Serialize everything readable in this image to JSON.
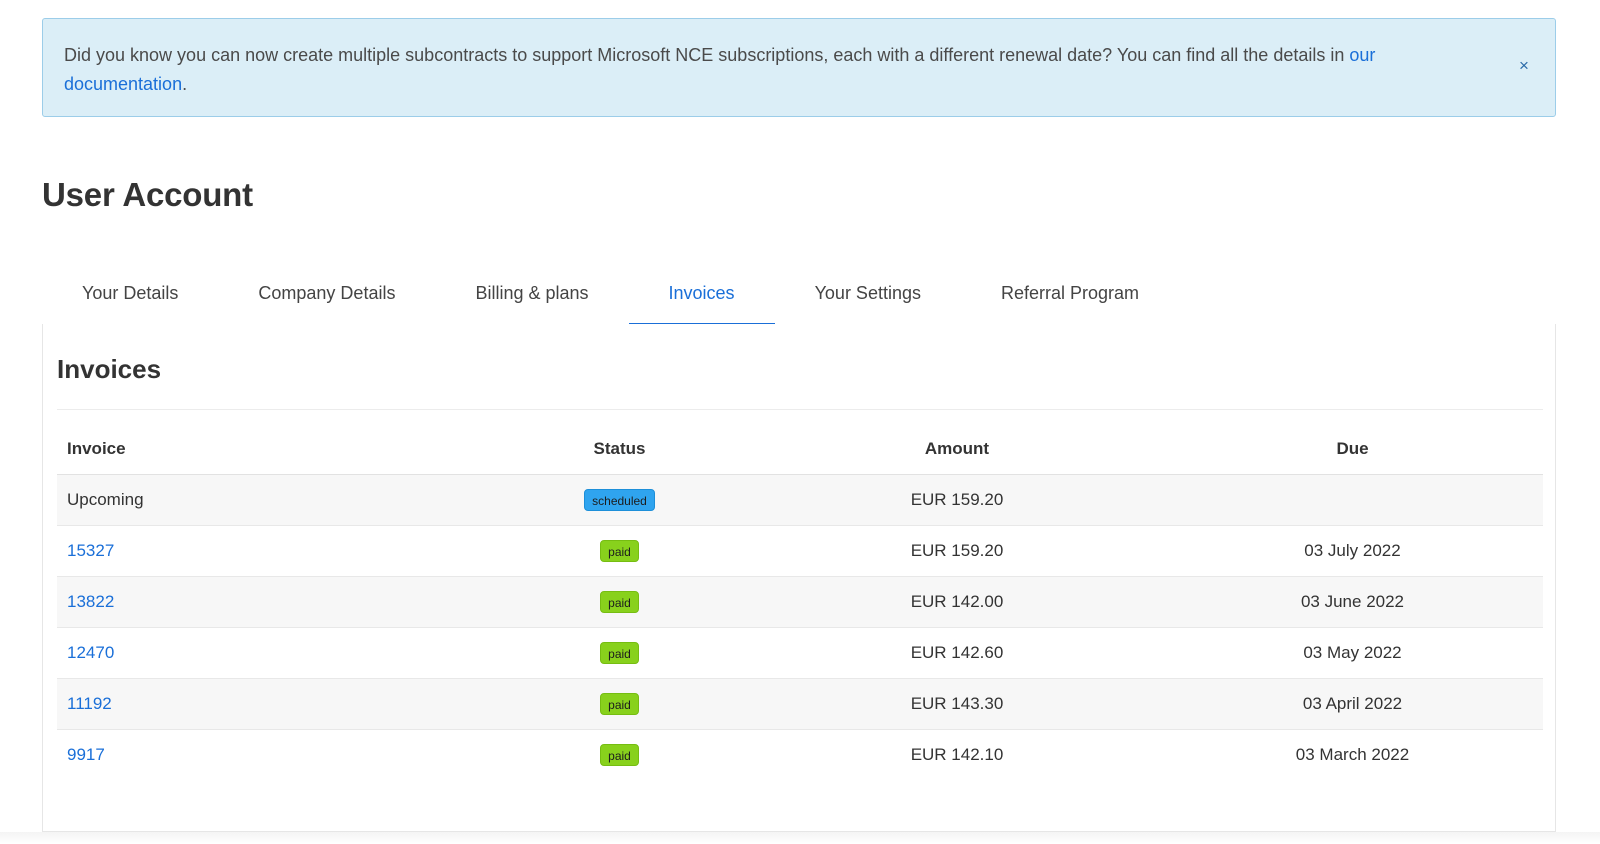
{
  "alert": {
    "text": "Did you know you can now create multiple subcontracts to support Microsoft NCE subscriptions, each with a different renewal date? You can find all the details in ",
    "link_text": "our documentation",
    "suffix": ".",
    "close_glyph": "×",
    "close_icon": "close-icon"
  },
  "page": {
    "title": "User Account"
  },
  "tabs": [
    {
      "label": "Your Details",
      "active": false
    },
    {
      "label": "Company Details",
      "active": false
    },
    {
      "label": "Billing & plans",
      "active": false
    },
    {
      "label": "Invoices",
      "active": true
    },
    {
      "label": "Your Settings",
      "active": false
    },
    {
      "label": "Referral Program",
      "active": false
    }
  ],
  "invoices": {
    "title": "Invoices",
    "columns": {
      "invoice": "Invoice",
      "status": "Status",
      "amount": "Amount",
      "due": "Due"
    },
    "rows": [
      {
        "invoice": "Upcoming",
        "is_link": false,
        "status": "scheduled",
        "amount": "EUR 159.20",
        "due": ""
      },
      {
        "invoice": "15327",
        "is_link": true,
        "status": "paid",
        "amount": "EUR 159.20",
        "due": "03 July 2022"
      },
      {
        "invoice": "13822",
        "is_link": true,
        "status": "paid",
        "amount": "EUR 142.00",
        "due": "03 June 2022"
      },
      {
        "invoice": "12470",
        "is_link": true,
        "status": "paid",
        "amount": "EUR 142.60",
        "due": "03 May 2022"
      },
      {
        "invoice": "11192",
        "is_link": true,
        "status": "paid",
        "amount": "EUR 143.30",
        "due": "03 April 2022"
      },
      {
        "invoice": "9917",
        "is_link": true,
        "status": "paid",
        "amount": "EUR 142.10",
        "due": "03 March 2022"
      }
    ]
  },
  "colors": {
    "accent": "#1a6fd8",
    "alert_bg": "#dbeef7",
    "status_scheduled": "#2fa4ef",
    "status_paid": "#88d11c"
  }
}
